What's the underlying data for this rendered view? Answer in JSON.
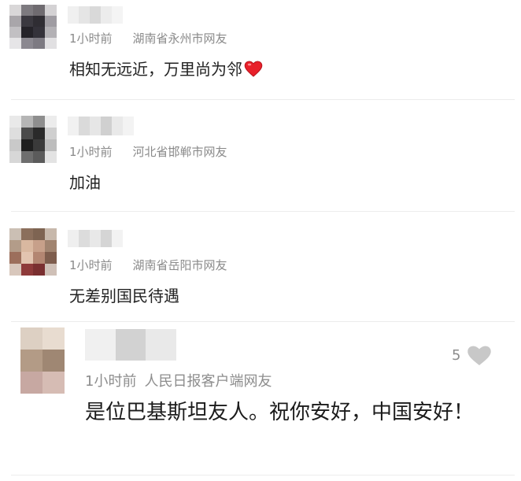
{
  "comments": [
    {
      "time": "1小时前",
      "location": "湖南省永州市网友",
      "text": "相知无远近，万里尚为邻",
      "emoji": "red-heart"
    },
    {
      "time": "1小时前",
      "location": "河北省邯郸市网友",
      "text": "加油"
    },
    {
      "time": "1小时前",
      "location": "湖南省岳阳市网友",
      "text": "无差别国民待遇"
    },
    {
      "time": "1小时前",
      "location": "人民日报客户端网友",
      "text": "是位巴基斯坦友人。祝你安好，中国安好！",
      "likes": "5"
    }
  ],
  "colors": {
    "meta_text": "#8a8a8a",
    "heart_red": "#e8202a",
    "like_icon": "#c8c8c8",
    "divider": "#ececec"
  }
}
